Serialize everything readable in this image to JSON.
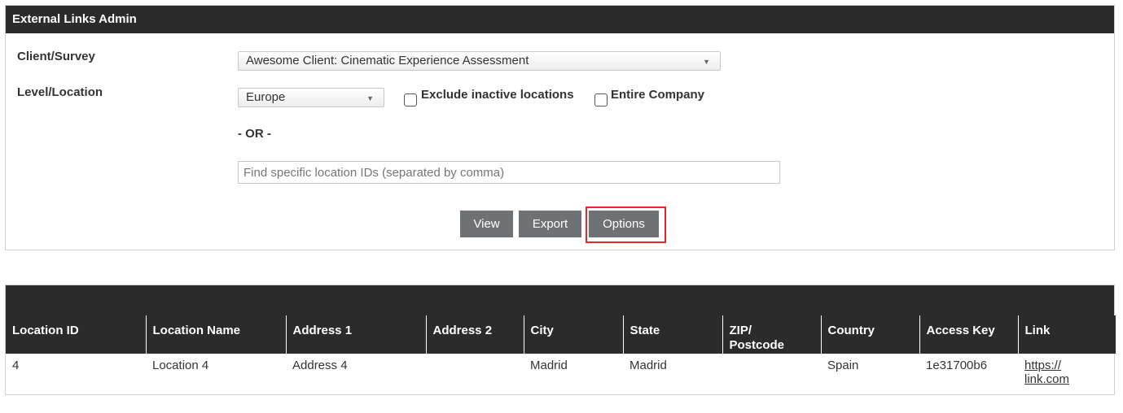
{
  "panel": {
    "title": "External Links Admin",
    "client_survey_label": "Client/Survey",
    "client_survey_value": "Awesome Client: Cinematic Experience Assessment",
    "level_location_label": "Level/Location",
    "level_location_value": "Europe",
    "exclude_inactive_label": "Exclude inactive locations",
    "entire_company_label": "Entire Company",
    "or_text": "- OR -",
    "location_ids_placeholder": "Find specific location IDs (separated by comma)",
    "buttons": {
      "view": "View",
      "export": "Export",
      "options": "Options"
    },
    "highlight_color": "#e3272b"
  },
  "table": {
    "columns": [
      "Location ID",
      "Location Name",
      "Address 1",
      "Address 2",
      "City",
      "State",
      "ZIP/ Postcode",
      "Country",
      "Access Key",
      "Link"
    ],
    "rows": [
      [
        "4",
        "Location 4",
        "Address 4",
        "",
        "Madrid",
        "Madrid",
        "",
        "Spain",
        "1e31700b6",
        "https:// link.com"
      ]
    ]
  },
  "colors": {
    "header_bg": "#2b2b2b",
    "button_bg": "#6e7275"
  }
}
